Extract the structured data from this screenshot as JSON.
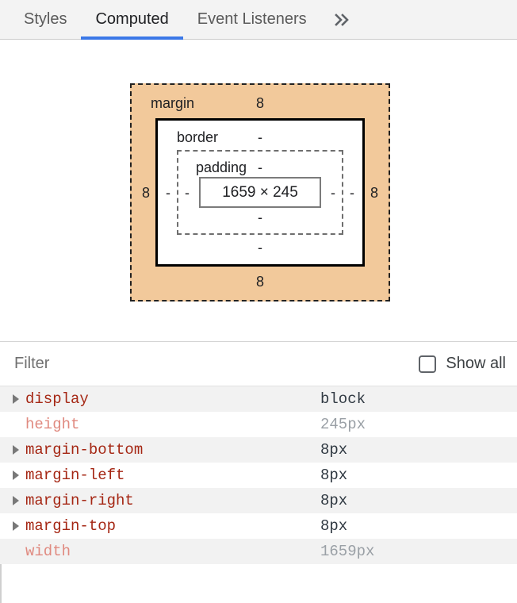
{
  "tabs": [
    {
      "label": "Styles",
      "active": false
    },
    {
      "label": "Computed",
      "active": true
    },
    {
      "label": "Event Listeners",
      "active": false
    }
  ],
  "tab_overflow_icon": "chevron-double-right-icon",
  "box_model": {
    "margin": {
      "label": "margin",
      "top": "8",
      "right": "8",
      "bottom": "8",
      "left": "8"
    },
    "border": {
      "label": "border",
      "top": "-",
      "right": "-",
      "bottom": "-",
      "left": "-"
    },
    "padding": {
      "label": "padding",
      "top": "-",
      "right": "-",
      "bottom": "-",
      "left": "-"
    },
    "content": {
      "dimensions": "1659 × 245"
    }
  },
  "filter": {
    "placeholder": "Filter",
    "value": "",
    "show_all_label": "Show all",
    "show_all_checked": false,
    "checkbox_icon": "checkbox-unchecked-icon"
  },
  "properties": [
    {
      "name": "display",
      "value": "block",
      "expandable": true,
      "dim": false
    },
    {
      "name": "height",
      "value": "245px",
      "expandable": false,
      "dim": true
    },
    {
      "name": "margin-bottom",
      "value": "8px",
      "expandable": true,
      "dim": false
    },
    {
      "name": "margin-left",
      "value": "8px",
      "expandable": true,
      "dim": false
    },
    {
      "name": "margin-right",
      "value": "8px",
      "expandable": true,
      "dim": false
    },
    {
      "name": "margin-top",
      "value": "8px",
      "expandable": true,
      "dim": false
    },
    {
      "name": "width",
      "value": "1659px",
      "expandable": false,
      "dim": true
    }
  ],
  "colors": {
    "accent": "#3b78e7",
    "margin_box": "#f2c99b",
    "property_name": "#a52714",
    "property_name_dim": "#e08a80",
    "property_value": "#303942",
    "property_value_dim": "#9aa0a6"
  }
}
